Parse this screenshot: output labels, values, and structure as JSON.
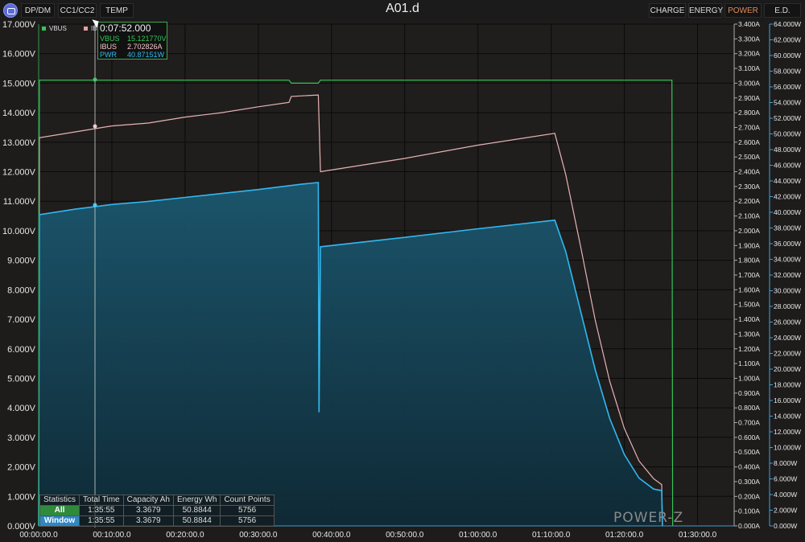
{
  "header": {
    "left_tabs": [
      "DP/DM",
      "CC1/CC2",
      "TEMP"
    ],
    "title": "A01.d",
    "right_tabs": [
      "CHARGE",
      "ENERGY",
      "POWER",
      "E.D."
    ],
    "active_right_tab": "POWER"
  },
  "tooltip": {
    "time": "0:07:52.000",
    "rows": [
      {
        "name": "VBUS",
        "value": "15.121770V",
        "color": "#36c45a"
      },
      {
        "name": "IBUS",
        "value": "2.702826A",
        "color": "#f3c7c7"
      },
      {
        "name": "PWR",
        "value": "40.87151W",
        "color": "#31b8f0"
      }
    ]
  },
  "legend": [
    {
      "name": "VBUS",
      "color": "#36c45a"
    },
    {
      "name": "IBUS",
      "color": "#e7a0a0"
    }
  ],
  "stats": {
    "headers": [
      "Statistics",
      "Total Time",
      "Capacity Ah",
      "Energy Wh",
      "Count Points"
    ],
    "rows": [
      {
        "label": "All",
        "values": [
          "1:35:55",
          "3.3679",
          "50.8844",
          "5756"
        ]
      },
      {
        "label": "Window",
        "values": [
          "1:35:55",
          "3.3679",
          "50.8844",
          "5756"
        ]
      }
    ]
  },
  "brand": "POWER-Z",
  "colors": {
    "vbus": "#36c45a",
    "ibus": "#e8b3b3",
    "pwr": "#31b8f0",
    "pwr_fill": "#1b5870",
    "grid": "#000000"
  },
  "chart_data": {
    "type": "line",
    "x_tick_labels": [
      "00:00:00.0",
      "00:10:00.0",
      "00:20:00.0",
      "00:30:00.0",
      "00:40:00.0",
      "00:50:00.0",
      "01:00:00.0",
      "01:10:00.0",
      "01:20:00.0",
      "01:30:00.0"
    ],
    "xlim": [
      0,
      95
    ],
    "left_axis": {
      "unit": "V",
      "ylim": [
        0,
        17
      ],
      "tick_labels": [
        "0.000V",
        "1.000V",
        "2.000V",
        "3.000V",
        "4.000V",
        "5.000V",
        "6.000V",
        "7.000V",
        "8.000V",
        "9.000V",
        "10.000V",
        "11.000V",
        "12.000V",
        "13.000V",
        "14.000V",
        "15.000V",
        "16.000V",
        "17.000V"
      ]
    },
    "mid_axis": {
      "unit": "A",
      "ylim": [
        0,
        3.4
      ],
      "tick_labels": [
        "0.000A",
        "0.100A",
        "0.200A",
        "0.300A",
        "0.400A",
        "0.500A",
        "0.600A",
        "0.700A",
        "0.800A",
        "0.900A",
        "1.000A",
        "1.100A",
        "1.200A",
        "1.300A",
        "1.400A",
        "1.500A",
        "1.600A",
        "1.700A",
        "1.800A",
        "1.900A",
        "2.000A",
        "2.100A",
        "2.200A",
        "2.300A",
        "2.400A",
        "2.500A",
        "2.600A",
        "2.700A",
        "2.800A",
        "2.900A",
        "3.000A",
        "3.100A",
        "3.200A",
        "3.300A",
        "3.400A"
      ]
    },
    "right_axis": {
      "unit": "W",
      "ylim": [
        0,
        64
      ],
      "tick_labels": [
        "0.000W",
        "2.000W",
        "4.000W",
        "6.000W",
        "8.000W",
        "10.000W",
        "12.000W",
        "14.000W",
        "16.000W",
        "18.000W",
        "20.000W",
        "22.000W",
        "24.000W",
        "26.000W",
        "28.000W",
        "30.000W",
        "32.000W",
        "34.000W",
        "36.000W",
        "38.000W",
        "40.000W",
        "42.000W",
        "44.000W",
        "46.000W",
        "48.000W",
        "50.000W",
        "52.000W",
        "54.000W",
        "56.000W",
        "58.000W",
        "60.000W",
        "62.000W",
        "64.000W"
      ]
    },
    "series": [
      {
        "name": "VBUS",
        "axis": "left",
        "points": [
          [
            0,
            0
          ],
          [
            0.1,
            15.1
          ],
          [
            34.2,
            15.1
          ],
          [
            34.5,
            15.0
          ],
          [
            38.2,
            15.0
          ],
          [
            38.5,
            15.1
          ],
          [
            86.5,
            15.1
          ],
          [
            86.6,
            0
          ]
        ]
      },
      {
        "name": "IBUS",
        "axis": "mid",
        "points": [
          [
            0,
            0
          ],
          [
            0.1,
            2.63
          ],
          [
            5,
            2.67
          ],
          [
            10,
            2.71
          ],
          [
            15,
            2.73
          ],
          [
            20,
            2.77
          ],
          [
            25,
            2.8
          ],
          [
            30,
            2.84
          ],
          [
            34.2,
            2.87
          ],
          [
            34.5,
            2.91
          ],
          [
            38.2,
            2.92
          ],
          [
            38.5,
            2.4
          ],
          [
            50,
            2.49
          ],
          [
            60,
            2.58
          ],
          [
            70.5,
            2.66
          ],
          [
            72,
            2.38
          ],
          [
            74,
            1.9
          ],
          [
            76,
            1.4
          ],
          [
            78,
            0.98
          ],
          [
            80,
            0.66
          ],
          [
            82,
            0.44
          ],
          [
            84,
            0.32
          ],
          [
            85.1,
            0.28
          ],
          [
            85.2,
            0
          ]
        ]
      },
      {
        "name": "PWR",
        "axis": "right",
        "points": [
          [
            0,
            0
          ],
          [
            0.1,
            39.7
          ],
          [
            5,
            40.4
          ],
          [
            10,
            41.0
          ],
          [
            15,
            41.4
          ],
          [
            20,
            41.9
          ],
          [
            25,
            42.4
          ],
          [
            30,
            42.9
          ],
          [
            36,
            43.6
          ],
          [
            38.2,
            43.8
          ],
          [
            38.3,
            14.5
          ],
          [
            38.5,
            35.6
          ],
          [
            50,
            36.8
          ],
          [
            60,
            37.9
          ],
          [
            70.5,
            39.0
          ],
          [
            72,
            35.0
          ],
          [
            74,
            27.5
          ],
          [
            76,
            20.0
          ],
          [
            78,
            13.7
          ],
          [
            80,
            9.1
          ],
          [
            82,
            6.1
          ],
          [
            84,
            4.7
          ],
          [
            85.1,
            4.5
          ],
          [
            85.2,
            0
          ]
        ]
      }
    ]
  }
}
